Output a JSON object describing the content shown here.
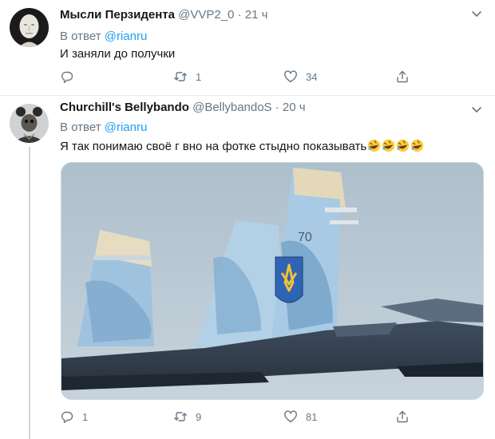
{
  "tweets": [
    {
      "display_name": "Мысли Перзидента",
      "handle": "@VVP2_0",
      "separator": "·",
      "time": "21 ч",
      "reply_prefix": "В ответ",
      "reply_to": "@rianru",
      "text": "И заняли до получки",
      "replies": "",
      "retweets": "1",
      "likes": "34"
    },
    {
      "display_name": "Churchill's Bellybando",
      "handle": "@BellybandoS",
      "separator": "·",
      "time": "20 ч",
      "reply_prefix": "В ответ",
      "reply_to": "@rianru",
      "text": "Я так понимаю своё г  вно на фотке стыдно показывать",
      "emoji": [
        "rolling-on-floor-laughing",
        "rolling-on-floor-laughing",
        "rolling-on-floor-laughing",
        "rolling-on-floor-laughing"
      ],
      "media": {
        "tail_marking": "70"
      },
      "replies": "1",
      "retweets": "9",
      "likes": "81"
    }
  ],
  "colors": {
    "link": "#1da1f2",
    "muted": "#657786",
    "text": "#14171a",
    "divider": "#e6ecf0"
  },
  "icons": [
    "chevron-down-icon",
    "reply-icon",
    "retweet-icon",
    "like-icon",
    "share-icon"
  ]
}
